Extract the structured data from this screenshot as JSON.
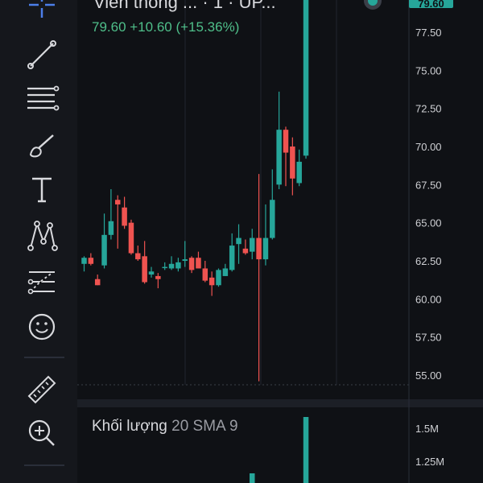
{
  "header": {
    "title": "Viễn thông ... · 1 · UP...",
    "change": "79.60  +10.60 (+15.36%)"
  },
  "last_price": "79.60",
  "price_axis": [
    "77.50",
    "75.00",
    "72.50",
    "70.00",
    "67.50",
    "65.00",
    "62.50",
    "60.00",
    "57.50",
    "55.00"
  ],
  "volume": {
    "title": "Khối lượng",
    "params": "20 SMA 9",
    "axis": [
      "1.5M",
      "1.25M"
    ]
  },
  "toolbar": {
    "tools": [
      "crosshair-icon",
      "trend-line-icon",
      "fib-lines-icon",
      "brush-icon",
      "text-icon",
      "pattern-icon",
      "forecast-icon",
      "emoji-icon",
      "ruler-icon",
      "zoom-in-icon"
    ]
  },
  "colors": {
    "up": "#26a69a",
    "down": "#ef5350",
    "background": "#0f1115",
    "toolbar": "#15171c"
  },
  "chart_data": {
    "type": "candlestick",
    "ylim": [
      54.0,
      80.5
    ],
    "candles": [
      {
        "o": 62.3,
        "h": 62.8,
        "l": 61.8,
        "c": 62.7
      },
      {
        "o": 62.7,
        "h": 63.0,
        "l": 62.2,
        "c": 62.3
      },
      {
        "o": 61.3,
        "h": 61.6,
        "l": 60.9,
        "c": 60.9
      },
      {
        "o": 62.2,
        "h": 65.6,
        "l": 62.0,
        "c": 64.2
      },
      {
        "o": 64.2,
        "h": 67.2,
        "l": 63.9,
        "c": 65.1
      },
      {
        "o": 66.5,
        "h": 66.8,
        "l": 63.3,
        "c": 66.2
      },
      {
        "o": 66.0,
        "h": 66.7,
        "l": 64.6,
        "c": 64.8
      },
      {
        "o": 65.0,
        "h": 65.2,
        "l": 62.9,
        "c": 63.0
      },
      {
        "o": 63.0,
        "h": 63.5,
        "l": 62.5,
        "c": 62.6
      },
      {
        "o": 62.8,
        "h": 63.8,
        "l": 61.0,
        "c": 61.1
      },
      {
        "o": 61.6,
        "h": 62.1,
        "l": 61.4,
        "c": 61.8
      },
      {
        "o": 61.5,
        "h": 61.7,
        "l": 60.7,
        "c": 61.3
      },
      {
        "o": 62.1,
        "h": 62.4,
        "l": 61.9,
        "c": 62.1
      },
      {
        "o": 62.0,
        "h": 62.8,
        "l": 61.9,
        "c": 62.3
      },
      {
        "o": 62.0,
        "h": 62.7,
        "l": 61.8,
        "c": 62.4
      },
      {
        "o": 62.5,
        "h": 63.8,
        "l": 62.1,
        "c": 62.6
      },
      {
        "o": 62.7,
        "h": 62.8,
        "l": 61.7,
        "c": 61.9
      },
      {
        "o": 62.7,
        "h": 63.1,
        "l": 62.0,
        "c": 62.0
      },
      {
        "o": 62.0,
        "h": 62.5,
        "l": 61.1,
        "c": 61.2
      },
      {
        "o": 61.4,
        "h": 61.8,
        "l": 60.2,
        "c": 60.9
      },
      {
        "o": 60.9,
        "h": 62.0,
        "l": 60.8,
        "c": 61.9
      },
      {
        "o": 61.5,
        "h": 62.3,
        "l": 61.5,
        "c": 62.0
      },
      {
        "o": 61.9,
        "h": 64.3,
        "l": 61.8,
        "c": 63.5
      },
      {
        "o": 63.6,
        "h": 64.9,
        "l": 62.3,
        "c": 64.0
      },
      {
        "o": 63.3,
        "h": 63.9,
        "l": 62.9,
        "c": 63.0
      },
      {
        "o": 63.1,
        "h": 64.6,
        "l": 62.6,
        "c": 64.0
      },
      {
        "o": 64.0,
        "h": 68.2,
        "l": 54.6,
        "c": 62.6
      },
      {
        "o": 62.6,
        "h": 66.2,
        "l": 62.2,
        "c": 64.0
      },
      {
        "o": 64.0,
        "h": 68.5,
        "l": 63.9,
        "c": 66.5
      },
      {
        "o": 67.5,
        "h": 73.6,
        "l": 67.2,
        "c": 71.1
      },
      {
        "o": 71.1,
        "h": 71.3,
        "l": 67.4,
        "c": 69.6
      },
      {
        "o": 70.0,
        "h": 70.6,
        "l": 66.8,
        "c": 67.9
      },
      {
        "o": 67.6,
        "h": 69.8,
        "l": 67.4,
        "c": 69.0
      },
      {
        "o": 69.4,
        "h": 80.5,
        "l": 69.2,
        "c": 80.5
      }
    ],
    "volume_ticks": [
      "1.5M",
      "1.25M"
    ],
    "volume_visible_bars": [
      {
        "index": 32,
        "value": "small"
      },
      {
        "index": 33,
        "value": "large"
      }
    ]
  }
}
